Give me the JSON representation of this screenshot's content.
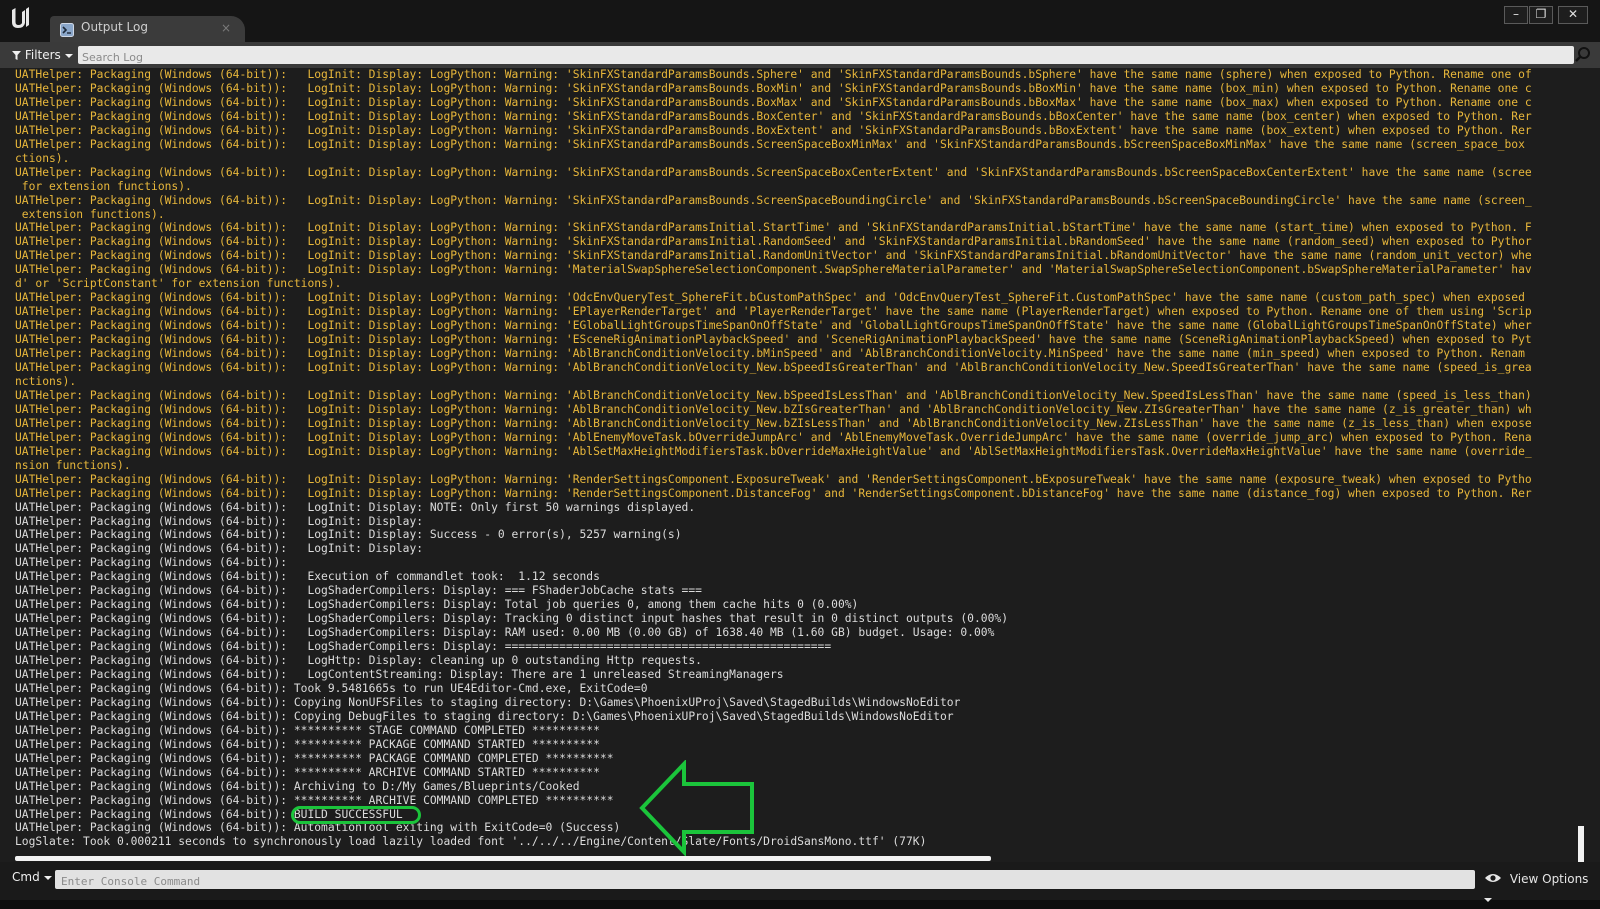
{
  "window": {
    "tab_title": "Output Log",
    "tab_close": "×",
    "minimize": "–",
    "maximize": "❐",
    "close": "✕"
  },
  "toolbar": {
    "filters_label": "Filters",
    "search_placeholder": "Search Log"
  },
  "log": {
    "lines": [
      {
        "type": "warn",
        "text": "UATHelper: Packaging (Windows (64-bit)):   LogInit: Display: LogPython: Warning: 'SkinFXStandardParamsBounds.Sphere' and 'SkinFXStandardParamsBounds.bSphere' have the same name (sphere) when exposed to Python. Rename one of"
      },
      {
        "type": "warn",
        "text": "UATHelper: Packaging (Windows (64-bit)):   LogInit: Display: LogPython: Warning: 'SkinFXStandardParamsBounds.BoxMin' and 'SkinFXStandardParamsBounds.bBoxMin' have the same name (box_min) when exposed to Python. Rename one c"
      },
      {
        "type": "warn",
        "text": "UATHelper: Packaging (Windows (64-bit)):   LogInit: Display: LogPython: Warning: 'SkinFXStandardParamsBounds.BoxMax' and 'SkinFXStandardParamsBounds.bBoxMax' have the same name (box_max) when exposed to Python. Rename one c"
      },
      {
        "type": "warn",
        "text": "UATHelper: Packaging (Windows (64-bit)):   LogInit: Display: LogPython: Warning: 'SkinFXStandardParamsBounds.BoxCenter' and 'SkinFXStandardParamsBounds.bBoxCenter' have the same name (box_center) when exposed to Python. Rer"
      },
      {
        "type": "warn",
        "text": "UATHelper: Packaging (Windows (64-bit)):   LogInit: Display: LogPython: Warning: 'SkinFXStandardParamsBounds.BoxExtent' and 'SkinFXStandardParamsBounds.bBoxExtent' have the same name (box_extent) when exposed to Python. Rer"
      },
      {
        "type": "warn",
        "text": "UATHelper: Packaging (Windows (64-bit)):   LogInit: Display: LogPython: Warning: 'SkinFXStandardParamsBounds.ScreenSpaceBoxMinMax' and 'SkinFXStandardParamsBounds.bScreenSpaceBoxMinMax' have the same name (screen_space_box"
      },
      {
        "type": "warn",
        "text": "ctions)."
      },
      {
        "type": "warn",
        "text": "UATHelper: Packaging (Windows (64-bit)):   LogInit: Display: LogPython: Warning: 'SkinFXStandardParamsBounds.ScreenSpaceBoxCenterExtent' and 'SkinFXStandardParamsBounds.bScreenSpaceBoxCenterExtent' have the same name (scree"
      },
      {
        "type": "warn",
        "text": " for extension functions)."
      },
      {
        "type": "warn",
        "text": "UATHelper: Packaging (Windows (64-bit)):   LogInit: Display: LogPython: Warning: 'SkinFXStandardParamsBounds.ScreenSpaceBoundingCircle' and 'SkinFXStandardParamsBounds.bScreenSpaceBoundingCircle' have the same name (screen_"
      },
      {
        "type": "warn",
        "text": " extension functions)."
      },
      {
        "type": "warn",
        "text": "UATHelper: Packaging (Windows (64-bit)):   LogInit: Display: LogPython: Warning: 'SkinFXStandardParamsInitial.StartTime' and 'SkinFXStandardParamsInitial.bStartTime' have the same name (start_time) when exposed to Python. F"
      },
      {
        "type": "warn",
        "text": "UATHelper: Packaging (Windows (64-bit)):   LogInit: Display: LogPython: Warning: 'SkinFXStandardParamsInitial.RandomSeed' and 'SkinFXStandardParamsInitial.bRandomSeed' have the same name (random_seed) when exposed to Pythor"
      },
      {
        "type": "warn",
        "text": "UATHelper: Packaging (Windows (64-bit)):   LogInit: Display: LogPython: Warning: 'SkinFXStandardParamsInitial.RandomUnitVector' and 'SkinFXStandardParamsInitial.bRandomUnitVector' have the same name (random_unit_vector) whe"
      },
      {
        "type": "warn",
        "text": "UATHelper: Packaging (Windows (64-bit)):   LogInit: Display: LogPython: Warning: 'MaterialSwapSphereSelectionComponent.SwapSphereMaterialParameter' and 'MaterialSwapSphereSelectionComponent.bSwapSphereMaterialParameter' hav"
      },
      {
        "type": "warn",
        "text": "d' or 'ScriptConstant' for extension functions)."
      },
      {
        "type": "warn",
        "text": "UATHelper: Packaging (Windows (64-bit)):   LogInit: Display: LogPython: Warning: 'OdcEnvQueryTest_SphereFit.bCustomPathSpec' and 'OdcEnvQueryTest_SphereFit.CustomPathSpec' have the same name (custom_path_spec) when exposed"
      },
      {
        "type": "warn",
        "text": "UATHelper: Packaging (Windows (64-bit)):   LogInit: Display: LogPython: Warning: 'EPlayerRenderTarget' and 'PlayerRenderTarget' have the same name (PlayerRenderTarget) when exposed to Python. Rename one of them using 'Scrip"
      },
      {
        "type": "warn",
        "text": "UATHelper: Packaging (Windows (64-bit)):   LogInit: Display: LogPython: Warning: 'EGlobalLightGroupsTimeSpanOnOffState' and 'GlobalLightGroupsTimeSpanOnOffState' have the same name (GlobalLightGroupsTimeSpanOnOffState) wher"
      },
      {
        "type": "warn",
        "text": "UATHelper: Packaging (Windows (64-bit)):   LogInit: Display: LogPython: Warning: 'ESceneRigAnimationPlaybackSpeed' and 'SceneRigAnimationPlaybackSpeed' have the same name (SceneRigAnimationPlaybackSpeed) when exposed to Pyt"
      },
      {
        "type": "warn",
        "text": "UATHelper: Packaging (Windows (64-bit)):   LogInit: Display: LogPython: Warning: 'AblBranchConditionVelocity.bMinSpeed' and 'AblBranchConditionVelocity.MinSpeed' have the same name (min_speed) when exposed to Python. Renam"
      },
      {
        "type": "warn",
        "text": "UATHelper: Packaging (Windows (64-bit)):   LogInit: Display: LogPython: Warning: 'AblBranchConditionVelocity_New.bSpeedIsGreaterThan' and 'AblBranchConditionVelocity_New.SpeedIsGreaterThan' have the same name (speed_is_grea"
      },
      {
        "type": "warn",
        "text": "nctions)."
      },
      {
        "type": "warn",
        "text": "UATHelper: Packaging (Windows (64-bit)):   LogInit: Display: LogPython: Warning: 'AblBranchConditionVelocity_New.bSpeedIsLessThan' and 'AblBranchConditionVelocity_New.SpeedIsLessThan' have the same name (speed_is_less_than)"
      },
      {
        "type": "warn",
        "text": "UATHelper: Packaging (Windows (64-bit)):   LogInit: Display: LogPython: Warning: 'AblBranchConditionVelocity_New.bZIsGreaterThan' and 'AblBranchConditionVelocity_New.ZIsGreaterThan' have the same name (z_is_greater_than) wh"
      },
      {
        "type": "warn",
        "text": "UATHelper: Packaging (Windows (64-bit)):   LogInit: Display: LogPython: Warning: 'AblBranchConditionVelocity_New.bZIsLessThan' and 'AblBranchConditionVelocity_New.ZIsLessThan' have the same name (z_is_less_than) when expose"
      },
      {
        "type": "warn",
        "text": "UATHelper: Packaging (Windows (64-bit)):   LogInit: Display: LogPython: Warning: 'AblEnemyMoveTask.bOverrideJumpArc' and 'AblEnemyMoveTask.OverrideJumpArc' have the same name (override_jump_arc) when exposed to Python. Rena"
      },
      {
        "type": "warn",
        "text": "UATHelper: Packaging (Windows (64-bit)):   LogInit: Display: LogPython: Warning: 'AblSetMaxHeightModifiersTask.bOverrideMaxHeightValue' and 'AblSetMaxHeightModifiersTask.OverrideMaxHeightValue' have the same name (override_"
      },
      {
        "type": "warn",
        "text": "nsion functions)."
      },
      {
        "type": "warn",
        "text": "UATHelper: Packaging (Windows (64-bit)):   LogInit: Display: LogPython: Warning: 'RenderSettingsComponent.ExposureTweak' and 'RenderSettingsComponent.bExposureTweak' have the same name (exposure_tweak) when exposed to Pytho"
      },
      {
        "type": "warn",
        "text": "UATHelper: Packaging (Windows (64-bit)):   LogInit: Display: LogPython: Warning: 'RenderSettingsComponent.DistanceFog' and 'RenderSettingsComponent.bDistanceFog' have the same name (distance_fog) when exposed to Python. Rer"
      },
      {
        "type": "info",
        "text": "UATHelper: Packaging (Windows (64-bit)):   LogInit: Display: NOTE: Only first 50 warnings displayed."
      },
      {
        "type": "info",
        "text": "UATHelper: Packaging (Windows (64-bit)):   LogInit: Display:"
      },
      {
        "type": "info",
        "text": "UATHelper: Packaging (Windows (64-bit)):   LogInit: Display: Success - 0 error(s), 5257 warning(s)"
      },
      {
        "type": "info",
        "text": "UATHelper: Packaging (Windows (64-bit)):   LogInit: Display:"
      },
      {
        "type": "info",
        "text": "UATHelper: Packaging (Windows (64-bit)):"
      },
      {
        "type": "info",
        "text": "UATHelper: Packaging (Windows (64-bit)):   Execution of commandlet took:  1.12 seconds"
      },
      {
        "type": "info",
        "text": "UATHelper: Packaging (Windows (64-bit)):   LogShaderCompilers: Display: === FShaderJobCache stats ==="
      },
      {
        "type": "info",
        "text": "UATHelper: Packaging (Windows (64-bit)):   LogShaderCompilers: Display: Total job queries 0, among them cache hits 0 (0.00%)"
      },
      {
        "type": "info",
        "text": "UATHelper: Packaging (Windows (64-bit)):   LogShaderCompilers: Display: Tracking 0 distinct input hashes that result in 0 distinct outputs (0.00%)"
      },
      {
        "type": "info",
        "text": "UATHelper: Packaging (Windows (64-bit)):   LogShaderCompilers: Display: RAM used: 0.00 MB (0.00 GB) of 1638.40 MB (1.60 GB) budget. Usage: 0.00%"
      },
      {
        "type": "info",
        "text": "UATHelper: Packaging (Windows (64-bit)):   LogShaderCompilers: Display: ================================================"
      },
      {
        "type": "info",
        "text": "UATHelper: Packaging (Windows (64-bit)):   LogHttp: Display: cleaning up 0 outstanding Http requests."
      },
      {
        "type": "info",
        "text": "UATHelper: Packaging (Windows (64-bit)):   LogContentStreaming: Display: There are 1 unreleased StreamingManagers"
      },
      {
        "type": "info",
        "text": "UATHelper: Packaging (Windows (64-bit)): Took 9.5481665s to run UE4Editor-Cmd.exe, ExitCode=0"
      },
      {
        "type": "info",
        "text": "UATHelper: Packaging (Windows (64-bit)): Copying NonUFSFiles to staging directory: D:\\Games\\PhoenixUProj\\Saved\\StagedBuilds\\WindowsNoEditor"
      },
      {
        "type": "info",
        "text": "UATHelper: Packaging (Windows (64-bit)): Copying DebugFiles to staging directory: D:\\Games\\PhoenixUProj\\Saved\\StagedBuilds\\WindowsNoEditor"
      },
      {
        "type": "info",
        "text": "UATHelper: Packaging (Windows (64-bit)): ********** STAGE COMMAND COMPLETED **********"
      },
      {
        "type": "info",
        "text": "UATHelper: Packaging (Windows (64-bit)): ********** PACKAGE COMMAND STARTED **********"
      },
      {
        "type": "info",
        "text": "UATHelper: Packaging (Windows (64-bit)): ********** PACKAGE COMMAND COMPLETED **********"
      },
      {
        "type": "info",
        "text": "UATHelper: Packaging (Windows (64-bit)): ********** ARCHIVE COMMAND STARTED **********"
      },
      {
        "type": "info",
        "text": "UATHelper: Packaging (Windows (64-bit)): Archiving to D:/My Games/Blueprints/Cooked"
      },
      {
        "type": "info",
        "text": "UATHelper: Packaging (Windows (64-bit)): ********** ARCHIVE COMMAND COMPLETED **********"
      },
      {
        "type": "info",
        "text": "UATHelper: Packaging (Windows (64-bit)): BUILD SUCCESSFUL"
      },
      {
        "type": "info",
        "text": "UATHelper: Packaging (Windows (64-bit)): AutomationTool exiting with ExitCode=0 (Success)"
      },
      {
        "type": "info",
        "text": "LogSlate: Took 0.000211 seconds to synchronously load lazily loaded font '../../../Engine/Content/Slate/Fonts/DroidSansMono.ttf' (77K)"
      }
    ]
  },
  "colors": {
    "warning": "#e8b73b",
    "info": "#dcdcdc",
    "highlight": "#1bc43b"
  },
  "console": {
    "cmd_label": "Cmd",
    "placeholder": "Enter Console Command",
    "view_options_label": "View Options"
  },
  "icons": [
    "unreal-logo-icon",
    "output-log-tab-icon",
    "filter-icon",
    "search-icon",
    "eye-icon",
    "dropdown-arrow-icon"
  ]
}
